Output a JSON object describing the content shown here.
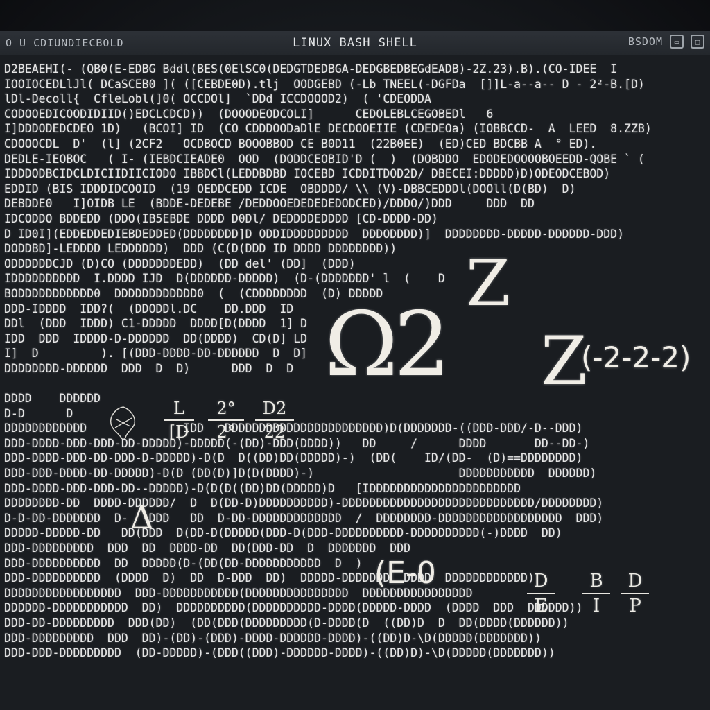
{
  "window": {
    "title": "LINUX BASH SHELL",
    "left_label": "O U  CDIUNDIECBOLD",
    "right_label": "BSDOM",
    "minimize_label": "▭",
    "maximize_label": "□"
  },
  "terminal": {
    "lines": [
      "D2BEAEHI(- (QB0(E-EDBG Bddl(BES(0ElSC0(DEDGTDEDBGA-DEDGBEDBEGdEADB)-2Z.23).B).(CO-IDEE  I",
      "IOOIOCEDLlJl( DCaSCEB0 ]( ([CEBDE0D).tlj  OODGEBD (-Lb TNEEL(-DGFDa  []]L-a--a-- D - 2²-B.[D)",
      "lDl-Decoll{  CfleLobl(]0( OCCDOl]  `DDd ICCDOOOD2)  ( 'CDEODDA",
      "CODOOEDICOODIDIID()EDCLCDCD))  (DOOODEODCOLI]      CEDOLEBLCEGOBEDl   6",
      "I]DDDODEDCDEO 1D)   (BCOI] ID  (CO CDDDOODaDlE DECDOOEIIE (CDEDEOa) (IOBBCCD-  A  LEED  8.ZZB)",
      "CDOOOCDL  D'  (l] (2CF2   OCDBOCD BOOOBBOD CE B0D11  (22B0EE)  (ED)CED BDCBB A  ° ED).",
      "DEDLE-IEOBOC   ( I- (IEBDCIEADE0  OOD  (DODDCEOBID'D (  )  (DOBDDO  EDODEDOOOOBOEEDD-QOBE ` (",
      "IDDDODBCIDCLDICIIDIICIODO IBBDCl(LEDDBDBD IOCEBD ICDDITDOD2D/ DBECEI:DDDDD)D)ODEODCEBOD)",
      "EDDID (BIS IDDDIDCOOID  (19 OEDDCEDD ICDE  OBDDDD/ \\\\ (V)-DBBCEDDDl(DOOll(D(BD)  D)  ",
      "DEBDDE0   I]OIDB LE  (BDDE-DEDEBE /DEDDOOEDEDEDEDODCED)/DDDO/)DDD     DDD  DD",
      "IDCODDO BDDEDD (DDO(IB5EBDE DDDD D0Dl/ DEDDDDEDDDD [CD-DDDD-DD)",
      "D ID0I](EDDEDDEDIEBDEDDED(DDDDDDDD]D ODDIDDDDDDDDD  DDDODDDD)]  DDDDDDDD-DDDDD-DDDDDD-DDD)",
      "DODDBD]-LEDDDD LEDDDDDD)  DDD (C(D(DDD ID DDDD DDDDDDDD))",
      "ODDDDDDCJD (D)CO (DDDDDDDEDD)  (DD del' (DD]  (DDD)",
      "IDDDDDDDDDD  I.DDDD IJD  D(DDDDDD-DDDDD)  (D-(DDDDDDD' l  (    D",
      "BODDDDDDDDDDD0  DDDDDDDDDDDD0  (  (CDDDDDDDD  (D) DDDDD",
      "DDD-IDDDD  IDD?(  (DDODDl.DC    DD.DDD  ID",
      "DDl  (DDD  IDDD) C1-DDDDD  DDDD[D(DDDD  1] D",
      "IDD  DDD  IDDDD-D-DDDDDD  DD(DDDD)  CD(D] LD",
      "I]  D         ). [(DDD-DDDD-DD-DDDDDD  D  D]",
      "DDDDDDDD-DDDDDD  DDD  D  D)      DDD  D  D",
      "",
      "DDDD    DDDDDD",
      "D-D      D",
      "DDDDDDDDDDDD              IDD   DDDDDDDDDDDDDDDDDDDDDDD)D(DDDDDDD-((DDD-DDD/-D--DDD)",
      "DDD-DDDD-DDD-DDD-DD-DDDDD)-DDDDD(-(DD)-DDD(DDDD))   DD     /      DDDD       DD--DD-)",
      "DDD-DDDD-DDD-DD-DDD-D-DDDDD)-D(D  D((DD)DD(DDDDD)-)  (DD(    ID/(DD-  (D)==DDDDDDDD)",
      "DDD-DDD-DDDD-DD-DDDDD)-D(D (DD(D)]D(D(DDDD)-)                     DDDDDDDDDDD  DDDDDD)",
      "DDD-DDDD-DDD-DDD-DD--DDDDD)-D(D(D((DD)DD(DDDDD)D   [IDDDDDDDDDDDDDDDDDDDDDD",
      "DDDDDDDD-DD  DDDD-DDDDDD/  D  D(DD-D)DDDDDDDDDD)-DDDDDDDDDDDDDDDDDDDDDDDDDDDD/DDDDDDDD)",
      "D-D-DD-DDDDDDD  D-  -DDD   DD  D-DD-DDDDDDDDDDDDD  /  DDDDDDDD-DDDDDDDDDDDDDDDDDD  DDD)",
      "DDDDD-DDDDD-DD   DD(DDD  D(DD-D(DDDDD(DDD-D(DDD-DDDDDDDDDD-DDDDDDDDDD(-)DDDD  DD)",
      "DDD-DDDDDDDDD  DDD  DD  DDDD-DD  DD(DDD-DD  D  DDDDDDD  DDD",
      "DDD-DDDDDDDDDD  DD  DDDDD(D-(DD(DD-DDDDDDDDDDD  D  )",
      "DDD-DDDDDDDDDD  (DDDD  D)  DD  D-DDD  DD)  DDDDD-DDDDDDD  DDDD  DDDDDDDDDDDD)",
      "DDDDDDDDDDDDDDDDD  DDD-DDDDDDDDDDD(DDDDDDDDDDDDDDD  DDDDDDDDDDDDDDDD",
      "DDDDDD-DDDDDDDDDDD  DD)  DDDDDDDDDD(DDDDDDDDDD-DDDD(DDDDD-DDDD  (DDDD  DDD  DDDDDD))",
      "DDD-DD-DDDDDDDDD  DDD(DD)  (DD(DDD(DDDDDDDDD(D-DDDD(D  ((DD)D  D  DD(DDDD(DDDDDD))",
      "DDD-DDDDDDDDD  DDD  DD)-(DD)-(DDD)-DDDD-DDDDDD-DDDD)-((DD)D-\\D(DDDDD(DDDDDDD))",
      "DDD-DDD-DDDDDDDDD  (DD-DDDDD)-(DDD((DDD)-DDDDDD-DDDD)-((DD)D)-\\D(DDDDD(DDDDDDD))"
    ]
  },
  "math": {
    "z_top": "Z",
    "o2": "Ω2",
    "z_right": "Z",
    "tail": "(-2-2-2)",
    "delta": "Δ",
    "e0": "(E-0",
    "fractions": [
      {
        "num": "L",
        "den": "[D"
      },
      {
        "num": "2°",
        "den": "2°"
      },
      {
        "num": "D2",
        "den": "22"
      },
      {
        "num": "D",
        "den": "E"
      },
      {
        "num": "B",
        "den": "I"
      },
      {
        "num": "D",
        "den": "P"
      }
    ]
  },
  "icons": {
    "sketch": "sketch-figure-icon"
  },
  "colors": {
    "background": "#1a1d21",
    "text": "#e6e6e6",
    "titlebar": "#2d3137"
  }
}
